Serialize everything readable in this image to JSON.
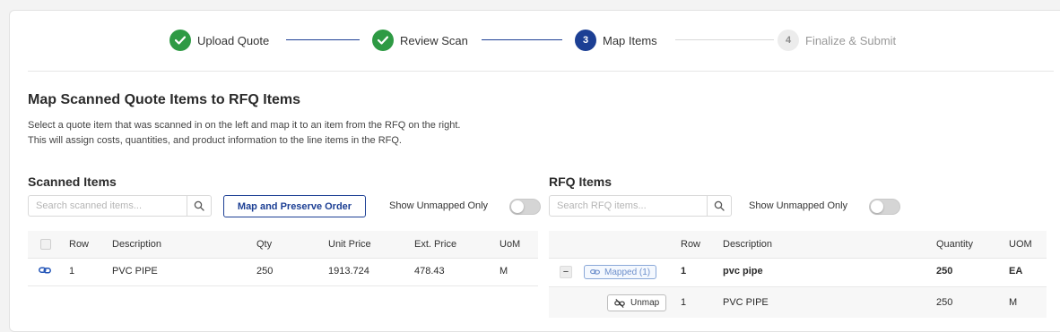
{
  "stepper": {
    "steps": [
      {
        "label": "Upload Quote",
        "number": "",
        "state": "done"
      },
      {
        "label": "Review Scan",
        "number": "",
        "state": "done"
      },
      {
        "label": "Map Items",
        "number": "3",
        "state": "active"
      },
      {
        "label": "Finalize & Submit",
        "number": "4",
        "state": "pending"
      }
    ]
  },
  "page": {
    "title": "Map Scanned Quote Items to RFQ Items",
    "description_line1": "Select a quote item that was scanned in on the left and map it to an item from the RFQ on the right.",
    "description_line2": "This will assign costs, quantities, and product information to the line items in the RFQ."
  },
  "scanned": {
    "title": "Scanned Items",
    "search_placeholder": "Search scanned items...",
    "map_button": "Map and Preserve Order",
    "toggle_label": "Show Unmapped Only",
    "toggle_on": false,
    "columns": [
      "Row",
      "Description",
      "Qty",
      "Unit Price",
      "Ext. Price",
      "UoM"
    ],
    "rows": [
      {
        "icon": "link-icon",
        "row": "1",
        "description": "PVC PIPE",
        "qty": "250",
        "unit_price": "1913.724",
        "ext_price": "478.43",
        "uom": "M"
      }
    ]
  },
  "rfq": {
    "title": "RFQ Items",
    "search_placeholder": "Search RFQ items...",
    "toggle_label": "Show Unmapped Only",
    "toggle_on": false,
    "columns": [
      "Row",
      "Description",
      "Quantity",
      "UOM"
    ],
    "rows": [
      {
        "toggle": "−",
        "badge": "Mapped (1)",
        "row": "1",
        "description": "pvc pipe",
        "quantity": "250",
        "uom": "EA"
      }
    ],
    "mapped_children": [
      {
        "action": "Unmap",
        "row": "1",
        "description": "PVC PIPE",
        "quantity": "250",
        "uom": "M"
      }
    ]
  },
  "colors": {
    "accent": "#1c3f94",
    "success": "#2e9a44",
    "mapped_badge": "#6d8fcb"
  }
}
